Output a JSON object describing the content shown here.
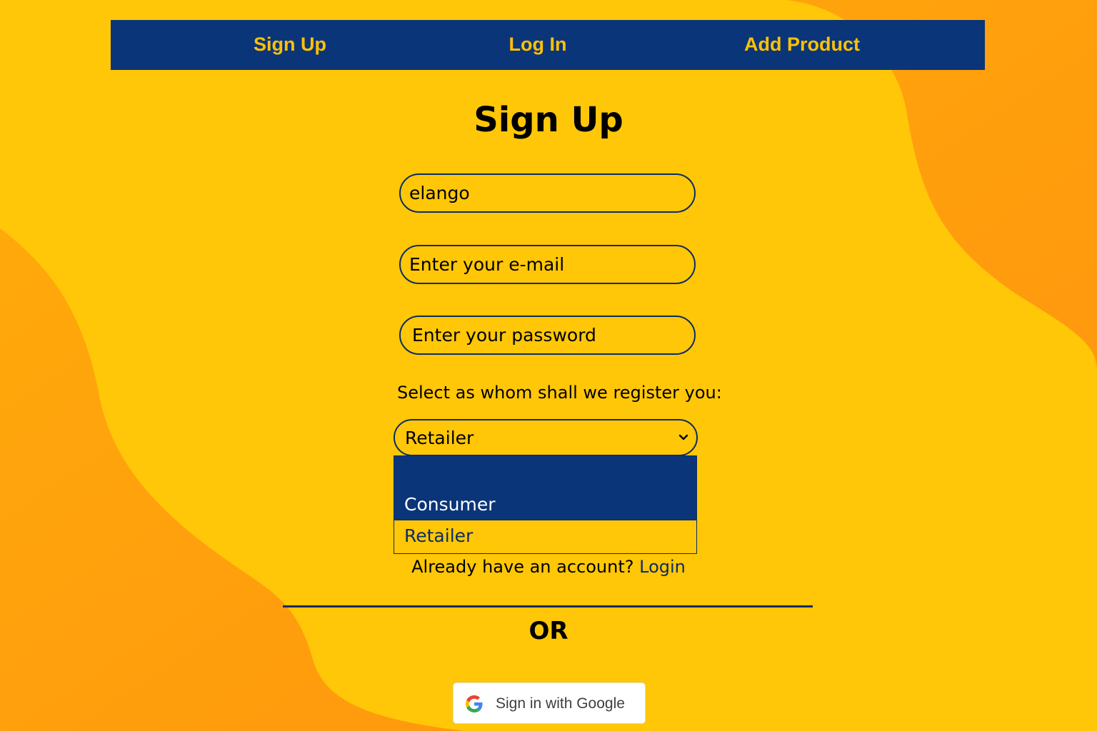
{
  "nav": {
    "links": [
      {
        "label": "Sign Up"
      },
      {
        "label": "Log In"
      },
      {
        "label": "Add Product"
      }
    ]
  },
  "page": {
    "title": "Sign Up"
  },
  "form": {
    "name_value": "elango",
    "email_placeholder": "Enter your e-mail",
    "password_placeholder": "Enter your password",
    "role_label": "Select as whom shall we register you:",
    "role_selected": "Retailer",
    "role_options": [
      "",
      "Consumer",
      "Retailer"
    ],
    "highlighted_option": "Consumer"
  },
  "footer": {
    "already_text": "Already have an account?",
    "login_label": "Login",
    "or_text": "OR",
    "google_label": "Sign in with Google"
  },
  "colors": {
    "background": "#ffc707",
    "background_wave": "#ff9a10",
    "nav": "#0b3579",
    "nav_text": "#ffc107",
    "border": "#0b2c64"
  }
}
